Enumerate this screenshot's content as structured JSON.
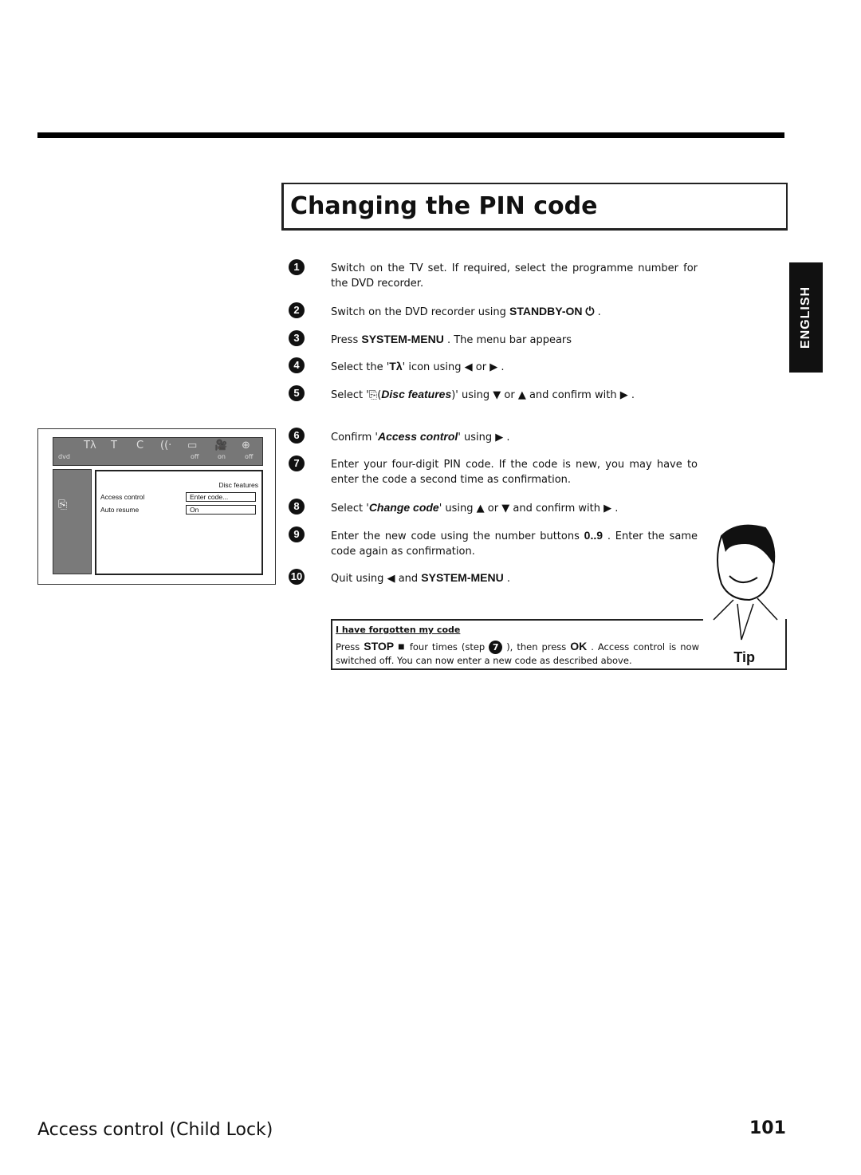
{
  "title": "Changing the PIN code",
  "language_tab": "ENGLISH",
  "steps": [
    {
      "n": "1",
      "text": "Switch on the TV set. If required, select the programme number for the DVD recorder."
    },
    {
      "n": "2",
      "pre": "Switch on the DVD recorder using ",
      "key": "STANDBY-ON ⏻",
      "post": " ."
    },
    {
      "n": "3",
      "pre": "Press ",
      "key": "SYSTEM-MENU",
      "post": " . The menu bar appears"
    },
    {
      "n": "4",
      "pre": "Select the '",
      "icon": "Tλ",
      "post": "' icon using ◀ or ▶ ."
    },
    {
      "n": "5",
      "pre": "Select '",
      "italic": "Disc features",
      "post": ")' using ▼ or ▲ and confirm with ▶ ."
    },
    {
      "n": "6",
      "pre": "Confirm '",
      "italic": "Access control",
      "post": "' using ▶ ."
    },
    {
      "n": "7",
      "text": "Enter your four-digit PIN code. If the code is new, you may have to enter the code a second time as confirmation."
    },
    {
      "n": "8",
      "pre": "Select '",
      "italic": "Change code",
      "post": "' using ▲ or ▼ and confirm with ▶ ."
    },
    {
      "n": "9",
      "pre": "Enter the new code using the number buttons ",
      "key": "0..9",
      "post": " . Enter the same code again as confirmation."
    },
    {
      "n": "10",
      "pre": "Quit using ◀ and ",
      "key": "SYSTEM-MENU",
      "post": " ."
    }
  ],
  "osd": {
    "bar_icons": [
      "Tλ",
      "T",
      "C",
      "((·",
      "▭",
      "🎥",
      "⊕"
    ],
    "bar_values": [
      "dvd",
      "off",
      "on",
      "off"
    ],
    "panel_title": "Disc features",
    "rows": [
      {
        "label": "Access control",
        "value": "Enter code..."
      },
      {
        "label": "Auto resume",
        "value": "On"
      }
    ]
  },
  "tip": {
    "heading": "I have forgotten my code",
    "pre": "Press ",
    "key1": "STOP ■",
    "mid1": " four times (step ",
    "step": "7",
    "mid2": " ), then press ",
    "key2": "OK",
    "post": " . Access control is now switched off. You can now enter a new code as described above.",
    "label": "Tip"
  },
  "footer": {
    "section": "Access control (Child Lock)",
    "page": "101"
  }
}
